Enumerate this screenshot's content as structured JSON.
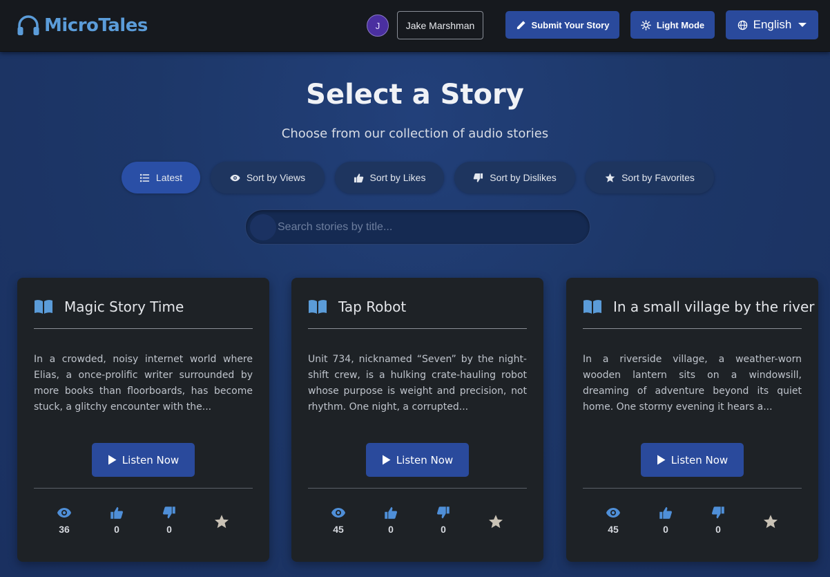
{
  "nav": {
    "brand": "MicroTales",
    "avatar_initial": "J",
    "username": "Jake Marshman",
    "submit_label": "Submit Your Story",
    "light_mode_label": "Light Mode",
    "language_label": "English"
  },
  "header": {
    "title": "Select a Story",
    "subtitle": "Choose from our collection of audio stories"
  },
  "sort": {
    "active": "Latest",
    "options": [
      {
        "label": "Latest",
        "icon": "list-icon"
      },
      {
        "label": "Sort by Views",
        "icon": "eye-icon"
      },
      {
        "label": "Sort by Likes",
        "icon": "thumbs-up-icon"
      },
      {
        "label": "Sort by Dislikes",
        "icon": "thumbs-down-icon"
      },
      {
        "label": "Sort by Favorites",
        "icon": "star-icon"
      }
    ]
  },
  "search": {
    "placeholder": "Search stories by title...",
    "value": ""
  },
  "stories": [
    {
      "title": "Magic Story Time",
      "excerpt": "In a crowded, noisy internet world where Elias, a once-prolific writer surrounded by more books than floorboards, has become stuck, a glitchy encounter with the...",
      "listen_label": "Listen Now",
      "views": "36",
      "likes": "0",
      "dislikes": "0"
    },
    {
      "title": "Tap Robot",
      "excerpt": "Unit 734, nicknamed “Seven” by the night-shift crew, is a hulking crate-hauling robot whose purpose is weight and precision, not rhythm. One night, a corrupted...",
      "listen_label": "Listen Now",
      "views": "45",
      "likes": "0",
      "dislikes": "0"
    },
    {
      "title": "In a small village by the river",
      "excerpt": "In a riverside village, a weather-worn wooden lantern sits on a windowsill, dreaming of adventure beyond its quiet home. One stormy evening it hears a...",
      "listen_label": "Listen Now",
      "views": "45",
      "likes": "0",
      "dislikes": "0"
    }
  ],
  "colors": {
    "accent": "#2a4a9c",
    "brand": "#5b9cd9",
    "icon_blue": "#4f8fd8",
    "star": "#c9c2b5",
    "card_bg": "#1e2226",
    "nav_bg": "#16191e"
  }
}
